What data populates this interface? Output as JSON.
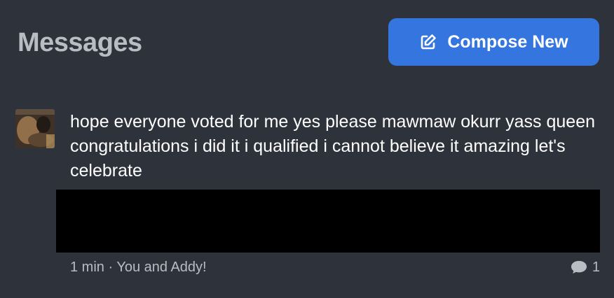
{
  "header": {
    "title": "Messages"
  },
  "compose": {
    "label": "Compose New",
    "icon": "edit-icon"
  },
  "message": {
    "avatar_icon": "user-avatar",
    "text": "hope everyone voted for me yes please mawmaw okurr yass queen congratulations i did it i qualified i cannot believe it amazing let's celebrate",
    "meta": "1 min · You and Addy!",
    "comment_icon": "comment-icon",
    "comment_count": "1"
  },
  "colors": {
    "background": "#2e323b",
    "accent": "#3475e0",
    "muted_text": "#b9bcc3",
    "media": "#000000"
  }
}
